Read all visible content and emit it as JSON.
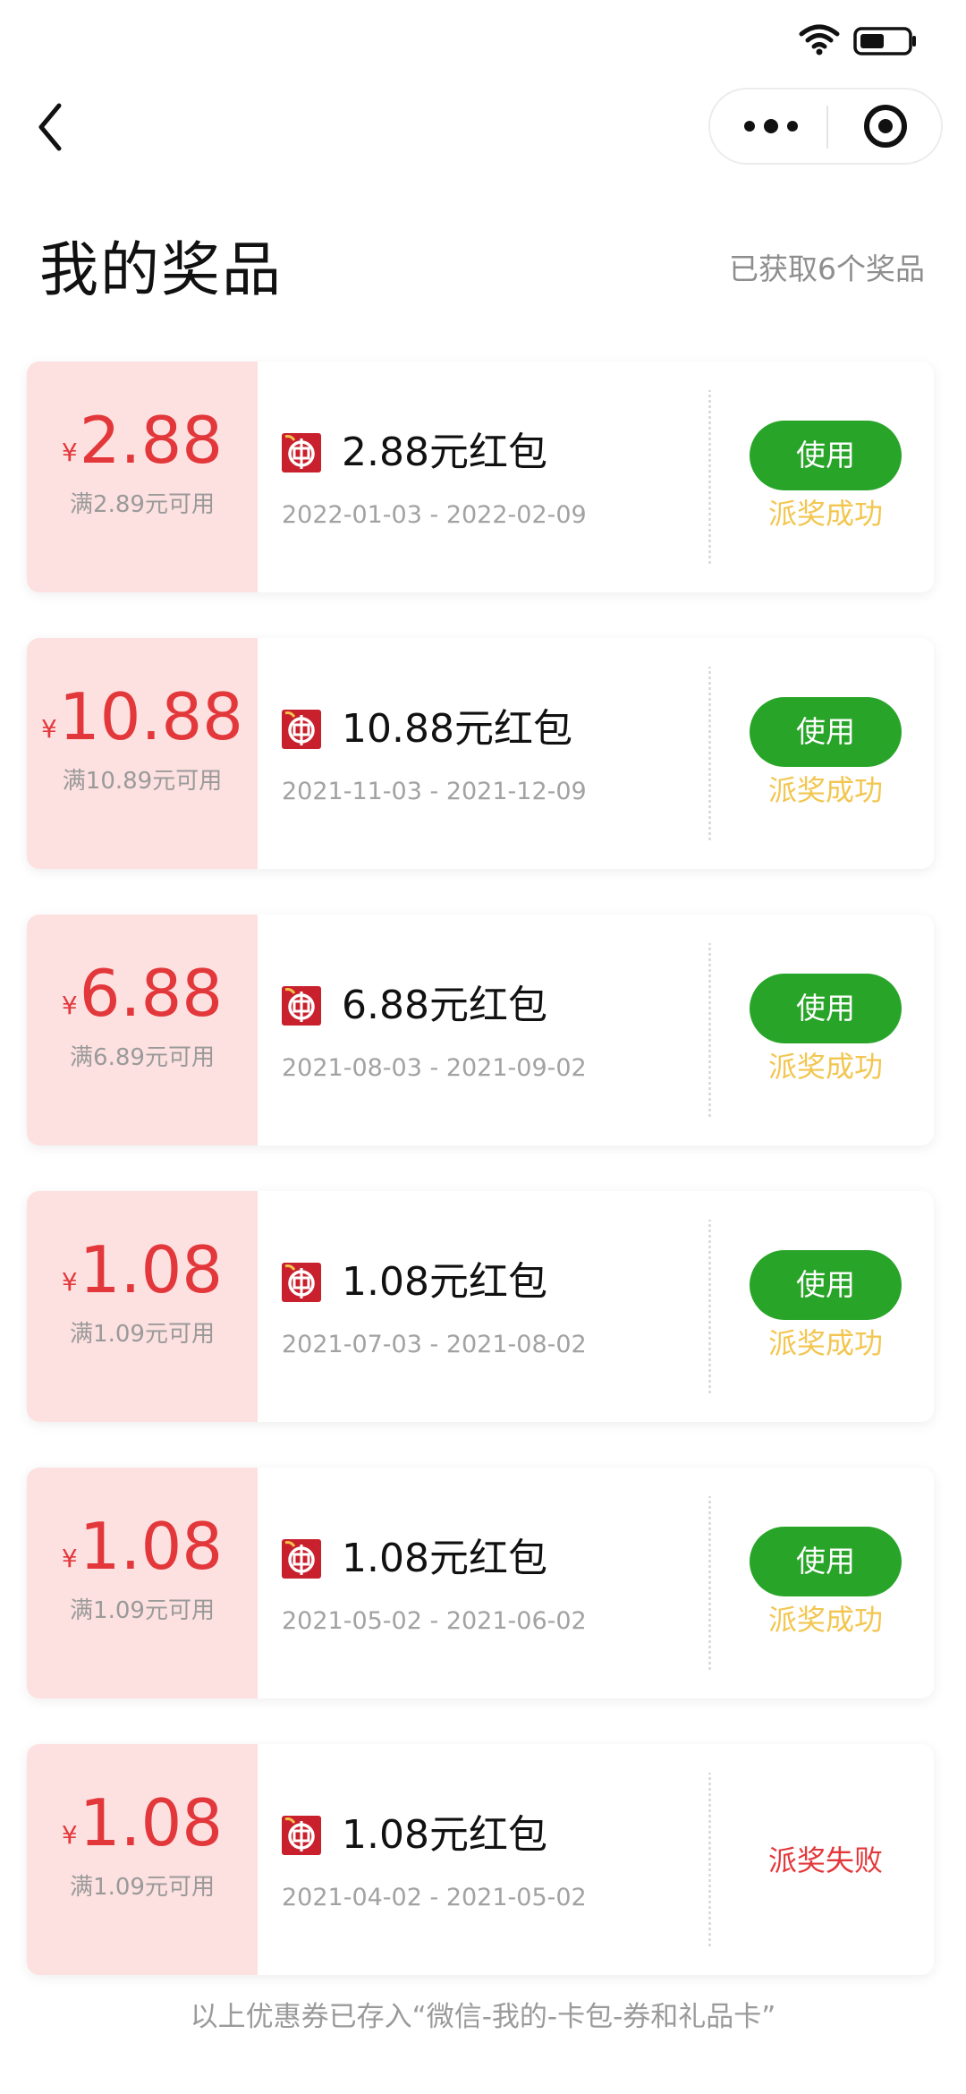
{
  "nav": {
    "back_icon": "chevron-left-icon",
    "more_icon": "more-dots-icon",
    "close_icon": "target-circle-icon"
  },
  "header": {
    "title": "我的奖品",
    "count_text": "已获取6个奖品"
  },
  "colors": {
    "accent_red": "#e3383b",
    "coupon_bg": "#fde0e0",
    "use_green": "#28a528",
    "success_yellow": "#f2c650"
  },
  "cards": [
    {
      "currency": "¥",
      "amount": "2.88",
      "min_spend": "满2.89元可用",
      "title": "2.88元红包",
      "validity": "2022-01-03 - 2022-02-09",
      "use_label": "使用",
      "status": "派奖成功",
      "status_type": "ok"
    },
    {
      "currency": "¥",
      "amount": "10.88",
      "min_spend": "满10.89元可用",
      "title": "10.88元红包",
      "validity": "2021-11-03 - 2021-12-09",
      "use_label": "使用",
      "status": "派奖成功",
      "status_type": "ok"
    },
    {
      "currency": "¥",
      "amount": "6.88",
      "min_spend": "满6.89元可用",
      "title": "6.88元红包",
      "validity": "2021-08-03 - 2021-09-02",
      "use_label": "使用",
      "status": "派奖成功",
      "status_type": "ok"
    },
    {
      "currency": "¥",
      "amount": "1.08",
      "min_spend": "满1.09元可用",
      "title": "1.08元红包",
      "validity": "2021-07-03 - 2021-08-02",
      "use_label": "使用",
      "status": "派奖成功",
      "status_type": "ok"
    },
    {
      "currency": "¥",
      "amount": "1.08",
      "min_spend": "满1.09元可用",
      "title": "1.08元红包",
      "validity": "2021-05-02 - 2021-06-02",
      "use_label": "使用",
      "status": "派奖成功",
      "status_type": "ok"
    },
    {
      "currency": "¥",
      "amount": "1.08",
      "min_spend": "满1.09元可用",
      "title": "1.08元红包",
      "validity": "2021-04-02 - 2021-05-02",
      "use_label": "",
      "status": "派奖失败",
      "status_type": "fail"
    }
  ],
  "footer": {
    "note": "以上优惠券已存入“微信-我的-卡包-券和礼品卡”"
  }
}
